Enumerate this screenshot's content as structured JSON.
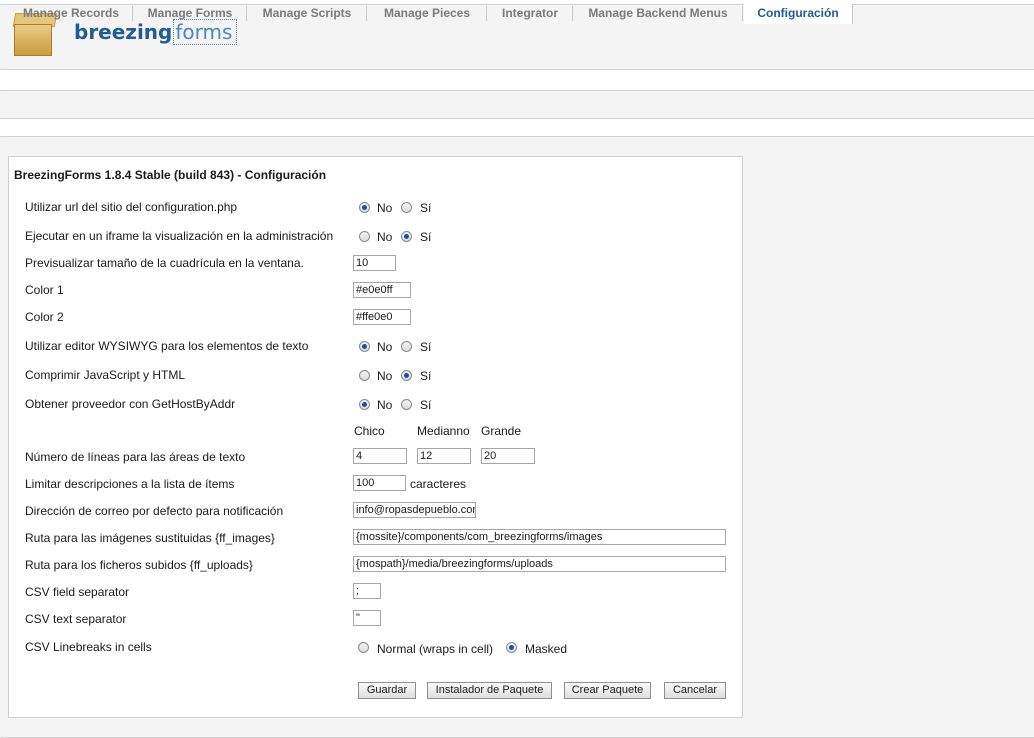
{
  "header": {
    "brand_bold": "breezing",
    "brand_light": "forms",
    "logo_icon": "package-box-icon"
  },
  "tabs": [
    {
      "label": "Manage Records"
    },
    {
      "label": "Manage Forms"
    },
    {
      "label": "Manage Scripts"
    },
    {
      "label": "Manage Pieces"
    },
    {
      "label": "Integrator"
    },
    {
      "label": "Manage Backend Menus"
    },
    {
      "label": "Configuración",
      "active": true
    }
  ],
  "config": {
    "title": "BreezingForms 1.8.4 Stable (build 843) - Configuración",
    "opt_no": "No",
    "opt_si": "Sí",
    "rows": {
      "use_site_url": {
        "label": "Utilizar url del sitio del configuration.php",
        "value": "No"
      },
      "iframe": {
        "label": "Ejecutar en un iframe la visualización en la administración",
        "value": "Sí"
      },
      "grid_preview": {
        "label": "Previsualizar tamaño de la cuadrícula en la ventana.",
        "value": "10"
      },
      "color1": {
        "label": "Color 1",
        "value": "#e0e0ff"
      },
      "color2": {
        "label": "Color 2",
        "value": "#ffe0e0"
      },
      "wysiwyg": {
        "label": "Utilizar editor WYSIWYG para los elementos de texto",
        "value": "No"
      },
      "compress": {
        "label": "Comprimir JavaScript y HTML",
        "value": "Sí"
      },
      "gethost": {
        "label": "Obtener proveedor con GetHostByAddr",
        "value": "No"
      },
      "textarea_lines": {
        "label": "Número de líneas para las áreas de texto",
        "col_small": "Chico",
        "col_medium": "Medianno",
        "col_large": "Grande",
        "small": "4",
        "medium": "12",
        "large": "20"
      },
      "limit_desc": {
        "label": "Limitar descripciones a la lista de ítems",
        "value": "100",
        "suffix": "caracteres"
      },
      "email": {
        "label": "Dirección de correo por defecto para notificación",
        "value": "info@ropasdepueblo.com"
      },
      "images_path": {
        "label": "Ruta para las imágenes sustituidas {ff_images}",
        "value": "{mossite}/components/com_breezingforms/images"
      },
      "uploads_path": {
        "label": "Ruta para los ficheros subidos {ff_uploads}",
        "value": "{mospath}/media/breezingforms/uploads"
      },
      "csv_field_sep": {
        "label": "CSV field separator",
        "value": ";"
      },
      "csv_text_sep": {
        "label": "CSV text separator",
        "value": "\""
      },
      "csv_linebreaks": {
        "label": "CSV Linebreaks in cells",
        "opt_normal": "Normal (wraps in cell)",
        "opt_masked": "Masked",
        "value": "Masked"
      }
    },
    "buttons": {
      "save": "Guardar",
      "installer": "Instalador de Paquete",
      "create": "Crear Paquete",
      "cancel": "Cancelar"
    }
  }
}
